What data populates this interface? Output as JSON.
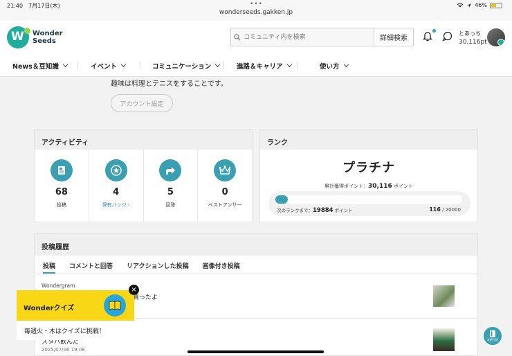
{
  "status_bar": {
    "time": "21:40",
    "date": "7月17日(木)",
    "url": "wonderseeds.gakken.jp",
    "battery": "46%"
  },
  "header": {
    "logo_line1": "Wonder",
    "logo_line2": "Seeds",
    "search_placeholder": "コミュニティ内を検索",
    "advanced_search": "詳細検索",
    "user_name": "とあっち",
    "user_points": "30,116pt"
  },
  "nav": {
    "items": [
      {
        "label": "News＆豆知識"
      },
      {
        "label": "イベント"
      },
      {
        "label": "コミュニケーション"
      },
      {
        "label": "進路＆キャリア"
      },
      {
        "label": "使い方"
      }
    ]
  },
  "profile": {
    "intro": "趣味は料理とテニスをすることです。",
    "account_settings": "アカウント設定"
  },
  "activity": {
    "title": "アクティビティ",
    "items": [
      {
        "value": "68",
        "label": "投稿",
        "icon": "document-icon"
      },
      {
        "value": "4",
        "label": "保有バッジ ›",
        "icon": "star-badge-icon"
      },
      {
        "value": "5",
        "label": "回答",
        "icon": "reply-arrow-icon"
      },
      {
        "value": "0",
        "label": "ベストアンサー",
        "icon": "crown-icon"
      }
    ]
  },
  "rank": {
    "title": "ランク",
    "name": "プラチナ",
    "total_label": "累計獲得ポイント：",
    "total_value": "30,116",
    "total_unit": "ポイント",
    "next_label": "次のランクまで：",
    "next_value": "19884",
    "next_unit": "ポイント",
    "progress_current": "116",
    "progress_total": "20000",
    "progress_fraction": 0.0058
  },
  "history": {
    "title": "投稿履歴",
    "tabs": [
      {
        "label": "投稿"
      },
      {
        "label": "コメントと回答"
      },
      {
        "label": "リアクションした投稿"
      },
      {
        "label": "画像付き投稿"
      }
    ],
    "posts": [
      {
        "category": "Wondergram",
        "title": "で買ったよ"
      },
      {
        "title": "スタバ飲んだ",
        "date": "2025/07/06 19:08"
      }
    ]
  },
  "quiz_popup": {
    "title": "Wonderクイズ",
    "body": "毎週火・木はクイズに挑戦！",
    "close": "×"
  },
  "fab_label": "学習日記",
  "colors": {
    "accent": "#3a9fb1",
    "brand": "#1fae9e",
    "quiz_yellow": "#f8d816"
  }
}
